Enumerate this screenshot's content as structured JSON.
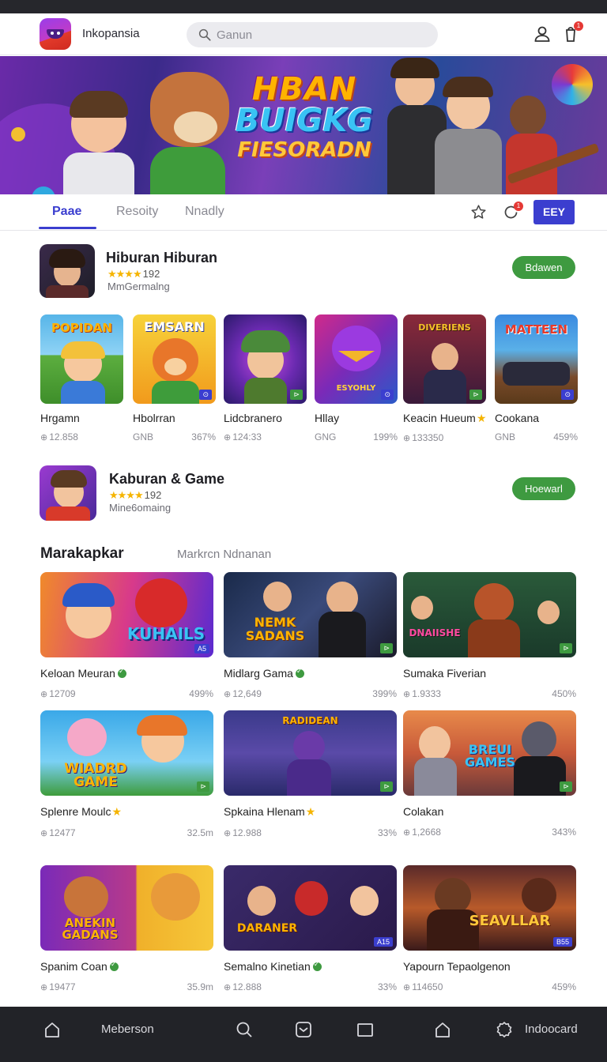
{
  "header": {
    "app_name": "Inkopansia",
    "search_placeholder": "Ganun",
    "notification_count": "1"
  },
  "tabs": [
    {
      "label": "Paae"
    },
    {
      "label": "Resoity"
    },
    {
      "label": "Nnadly"
    }
  ],
  "tab_actions": {
    "notification_count": "1",
    "primary_button": "EEY"
  },
  "banner": {
    "line1": "HBAN",
    "line2": "BUIGKG",
    "line3": "FIESORADN"
  },
  "featured": [
    {
      "title": "Hiburan Hiburan",
      "stars": "★★★★",
      "rating": "192",
      "developer": "MmGermalng",
      "button": "Bdawen"
    },
    {
      "title": "Kaburan & Game",
      "stars": "★★★★",
      "rating": "192",
      "developer": "Mine6omaing",
      "button": "Hoewarl"
    }
  ],
  "small_games": [
    {
      "thumb_text": "POPIDAN",
      "title": "Hrgamn",
      "downloads": "12.858",
      "size": ""
    },
    {
      "thumb_text": "EMSARN",
      "title": "Hbolrran",
      "downloads": "GNB",
      "size": "367%"
    },
    {
      "thumb_text": "",
      "title": "Lidcbranero",
      "downloads": "124:33",
      "size": ""
    },
    {
      "thumb_text": "ESYOHLY",
      "title": "Hllay",
      "downloads": "GNG",
      "size": "199%"
    },
    {
      "thumb_text": "DIVERIENS",
      "title": "Keacin Hueum",
      "downloads": "133350",
      "size": ""
    },
    {
      "thumb_text": "MATTEEN",
      "title": "Cookana",
      "downloads": "GNB",
      "size": "459%"
    }
  ],
  "section": {
    "title": "Marakapkar",
    "subtitle": "Markrcn Ndnanan"
  },
  "big_games": [
    {
      "thumb_text": "KUHAILS",
      "title": "Keloan Meuran",
      "mark": "verified",
      "downloads": "12709",
      "size": "499%"
    },
    {
      "thumb_text": "NEMK SADANS",
      "title": "Midlarg Gama",
      "mark": "verified",
      "downloads": "12,649",
      "size": "399%"
    },
    {
      "thumb_text": "DNAIISHE",
      "title": "Sumaka Fiverian",
      "mark": "",
      "downloads": "1.9333",
      "size": "450%"
    },
    {
      "thumb_text": "WIADRD GAME",
      "title": "Splenre Moulc",
      "mark": "star",
      "downloads": "12477",
      "size": "32.5m"
    },
    {
      "thumb_text": "RADIDEAN",
      "title": "Spkaina Hlenam",
      "mark": "star",
      "downloads": "12.988",
      "size": "33%"
    },
    {
      "thumb_text": "BREUI GAMES",
      "title": "Colakan",
      "mark": "",
      "downloads": "1,2668",
      "size": "343%"
    },
    {
      "thumb_text": "ANEKIN GADANS",
      "title": "Spanim Coan",
      "mark": "verified",
      "downloads": "19477",
      "size": "35.9m"
    },
    {
      "thumb_text": "DARANER",
      "title": "Semalno Kinetian",
      "mark": "verified",
      "downloads": "12.888",
      "size": "33%"
    },
    {
      "thumb_text": "SEAVLLAR",
      "title": "Yapourn Tepaolgenon",
      "mark": "",
      "downloads": "114650",
      "size": "459%"
    }
  ],
  "bottom_nav": [
    {
      "icon": "home-icon",
      "label": "Meberson"
    },
    {
      "icon": "search-icon",
      "label": ""
    },
    {
      "icon": "tray-icon",
      "label": ""
    },
    {
      "icon": "window-icon",
      "label": ""
    },
    {
      "icon": "home-outline-icon",
      "label": ""
    },
    {
      "icon": "settings-icon",
      "label": "Indoocard"
    }
  ],
  "colors": {
    "accent": "#3b3ecf",
    "green_button": "#3e9a40",
    "nav_bg": "#222328",
    "star": "#f5b400"
  }
}
